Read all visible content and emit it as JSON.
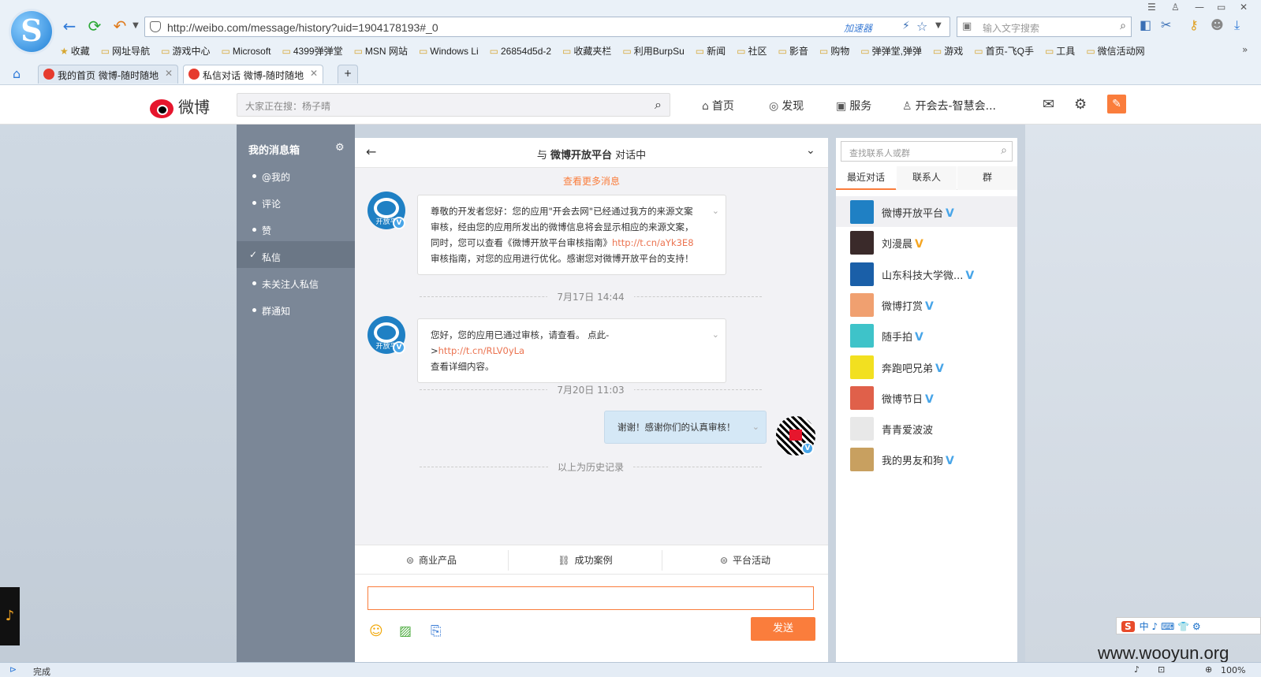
{
  "browser": {
    "url": "http://weibo.com/message/history?uid=1904178193#_0",
    "accelerator_label": "加速器",
    "search_placeholder": "输入文字搜索",
    "bookmarks": [
      "收藏",
      "网址导航",
      "游戏中心",
      "Microsoft",
      "4399弹弹堂",
      "MSN 网站",
      "Windows Li",
      "26854d5d-2",
      "收藏夹栏",
      "利用BurpSu",
      "新闻",
      "社区",
      "影音",
      "购物",
      "弹弹堂,弹弹",
      "游戏",
      "首页-飞Q手",
      "工具",
      "微信活动网"
    ],
    "tabs": [
      {
        "label": "我的首页 微博-随时随地"
      },
      {
        "label": "私信对话 微博-随时随地"
      }
    ],
    "new_tab": "+",
    "status_text": "完成",
    "zoom": "100%"
  },
  "weibo": {
    "logo_text": "微博",
    "search_placeholder": "大家正在搜：杨子晴",
    "nav": {
      "home": "首页",
      "discover": "发现",
      "service": "服务",
      "user": "开会去-智慧会..."
    }
  },
  "sidebar": {
    "title": "我的消息箱",
    "items": [
      {
        "label": "@我的"
      },
      {
        "label": "评论"
      },
      {
        "label": "赞"
      },
      {
        "label": "私信"
      },
      {
        "label": "未关注人私信"
      },
      {
        "label": "群通知"
      }
    ],
    "active_index": 3
  },
  "chat": {
    "title_prefix": "与",
    "title_name": "微博开放平台",
    "title_suffix": "对话中",
    "more_messages": "查看更多消息",
    "avatar_label": "开放平",
    "messages": [
      {
        "text_a": "尊敬的开发者您好：您的应用\"开会去网\"已经通过我方的来源文案审核，经由您的应用所发出的微博信息将会显示相应的来源文案，同时，您可以查看《微博开放平台审核指南》",
        "link": "http://t.cn/aYk3E8",
        "text_b": "审核指南，对您的应用进行优化。感谢您对微博开放平台的支持！"
      },
      {
        "text_a": "您好，您的应用已通过审核，请查看。 点此->",
        "link": "http://t.cn/RLV0yLa",
        "text_b": "查看详细内容。"
      }
    ],
    "date1": "7月17日 14:44",
    "date2": "7月20日 11:03",
    "my_message": "谢谢！感谢你们的认真审核！",
    "history_end": "以上为历史记录",
    "tools": [
      "商业产品",
      "成功案例",
      "平台活动"
    ],
    "send_label": "发送"
  },
  "contacts": {
    "search_placeholder": "查找联系人或群",
    "tabs": [
      "最近对话",
      "联系人",
      "群"
    ],
    "list": [
      {
        "name": "微博开放平台",
        "badge": "V",
        "badge_color": "#48a5e8",
        "avatar_color": "#1f80c4"
      },
      {
        "name": "刘漫晨",
        "badge": "V",
        "badge_color": "#f5a623",
        "avatar_color": "#3a2a2a"
      },
      {
        "name": "山东科技大学微...",
        "badge": "V",
        "badge_color": "#48a5e8",
        "avatar_color": "#1a5fa8"
      },
      {
        "name": "微博打赏",
        "badge": "V",
        "badge_color": "#48a5e8",
        "avatar_color": "#f0a070"
      },
      {
        "name": "随手拍",
        "badge": "V",
        "badge_color": "#48a5e8",
        "avatar_color": "#3ec3c9"
      },
      {
        "name": "奔跑吧兄弟",
        "badge": "V",
        "badge_color": "#48a5e8",
        "avatar_color": "#f2e020"
      },
      {
        "name": "微博节日",
        "badge": "V",
        "badge_color": "#48a5e8",
        "avatar_color": "#e0604a"
      },
      {
        "name": "青青爱波波",
        "badge": "",
        "badge_color": "",
        "avatar_color": "#e8e8e8"
      },
      {
        "name": "我的男友和狗",
        "badge": "V",
        "badge_color": "#48a5e8",
        "avatar_color": "#c8a060"
      }
    ]
  },
  "ime": {
    "logo": "S",
    "text": "中 ♪ ⌨ 👕 ⚙"
  },
  "watermark": "www.wooyun.org"
}
